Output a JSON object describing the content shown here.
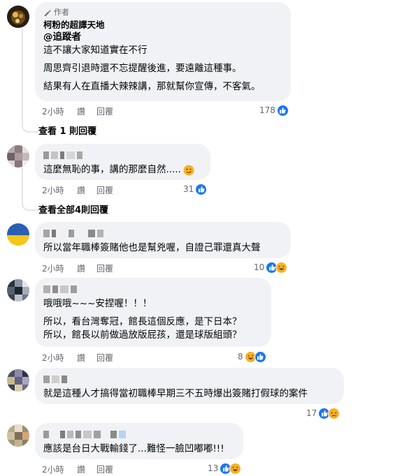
{
  "comments": [
    {
      "badge": "作者",
      "author": "柯粉的超譯天地",
      "mention": "@追蹤者",
      "paragraphs": [
        "這不讓大家知道實在不行",
        "周思齊引退時還不忘提醒後進，要遠離這種事。",
        "結果有人在直播大辣辣講，那就幫你宣傳，不客氣。"
      ],
      "time": "2小時",
      "like_label": "讚",
      "reply_label": "回覆",
      "reaction_count": "178",
      "reactions": [
        "like-icon"
      ],
      "view_replies": "查看 1 則回覆"
    },
    {
      "paragraphs": [
        "這麼無恥的事，講的那麼自然....."
      ],
      "emoji": "smirk-emoji",
      "time": "2小時",
      "like_label": "讚",
      "reply_label": "回覆",
      "reaction_count": "31",
      "reactions": [
        "like-icon"
      ],
      "view_replies": "查看全部4則回覆"
    },
    {
      "paragraphs": [
        "所以當年職棒簽賭他也是幫兇喔，自證己罪還真大聲"
      ],
      "time": "2小時",
      "like_label": "讚",
      "reply_label": "回覆",
      "reaction_count": "10",
      "reactions": [
        "like-icon",
        "haha-icon"
      ]
    },
    {
      "paragraphs": [
        "哦哦哦~~~安捏喔！！！",
        "所以，看台灣奪冠，館長這個反應，是下日本？",
        "所以，館長以前做過放版屁孩，還是球版組頭？"
      ],
      "time": "2小時",
      "like_label": "讚",
      "reply_label": "回覆",
      "reaction_count": "8",
      "reactions": [
        "haha-icon",
        "like-icon"
      ]
    },
    {
      "paragraphs": [
        "就是這種人才搞得當初職棒早期三不五時爆出簽賭打假球的案件"
      ],
      "time": "2小時",
      "like_label": "讚",
      "reply_label": "回覆",
      "reaction_count": "17",
      "reactions": [
        "like-icon",
        "sad-icon"
      ]
    },
    {
      "paragraphs": [
        "應該是台日大戰輸錢了...難怪一臉凹嘟嘟!!!"
      ],
      "time": "2小時",
      "like_label": "讚",
      "reply_label": "回覆",
      "reaction_count": "13",
      "reactions": [
        "like-icon",
        "haha-icon"
      ]
    }
  ],
  "colors": {
    "bubble": "#f0f2f5",
    "meta_text": "#65676b",
    "like_blue": "#1877f2",
    "emoji_yellow": "#f7b125"
  }
}
